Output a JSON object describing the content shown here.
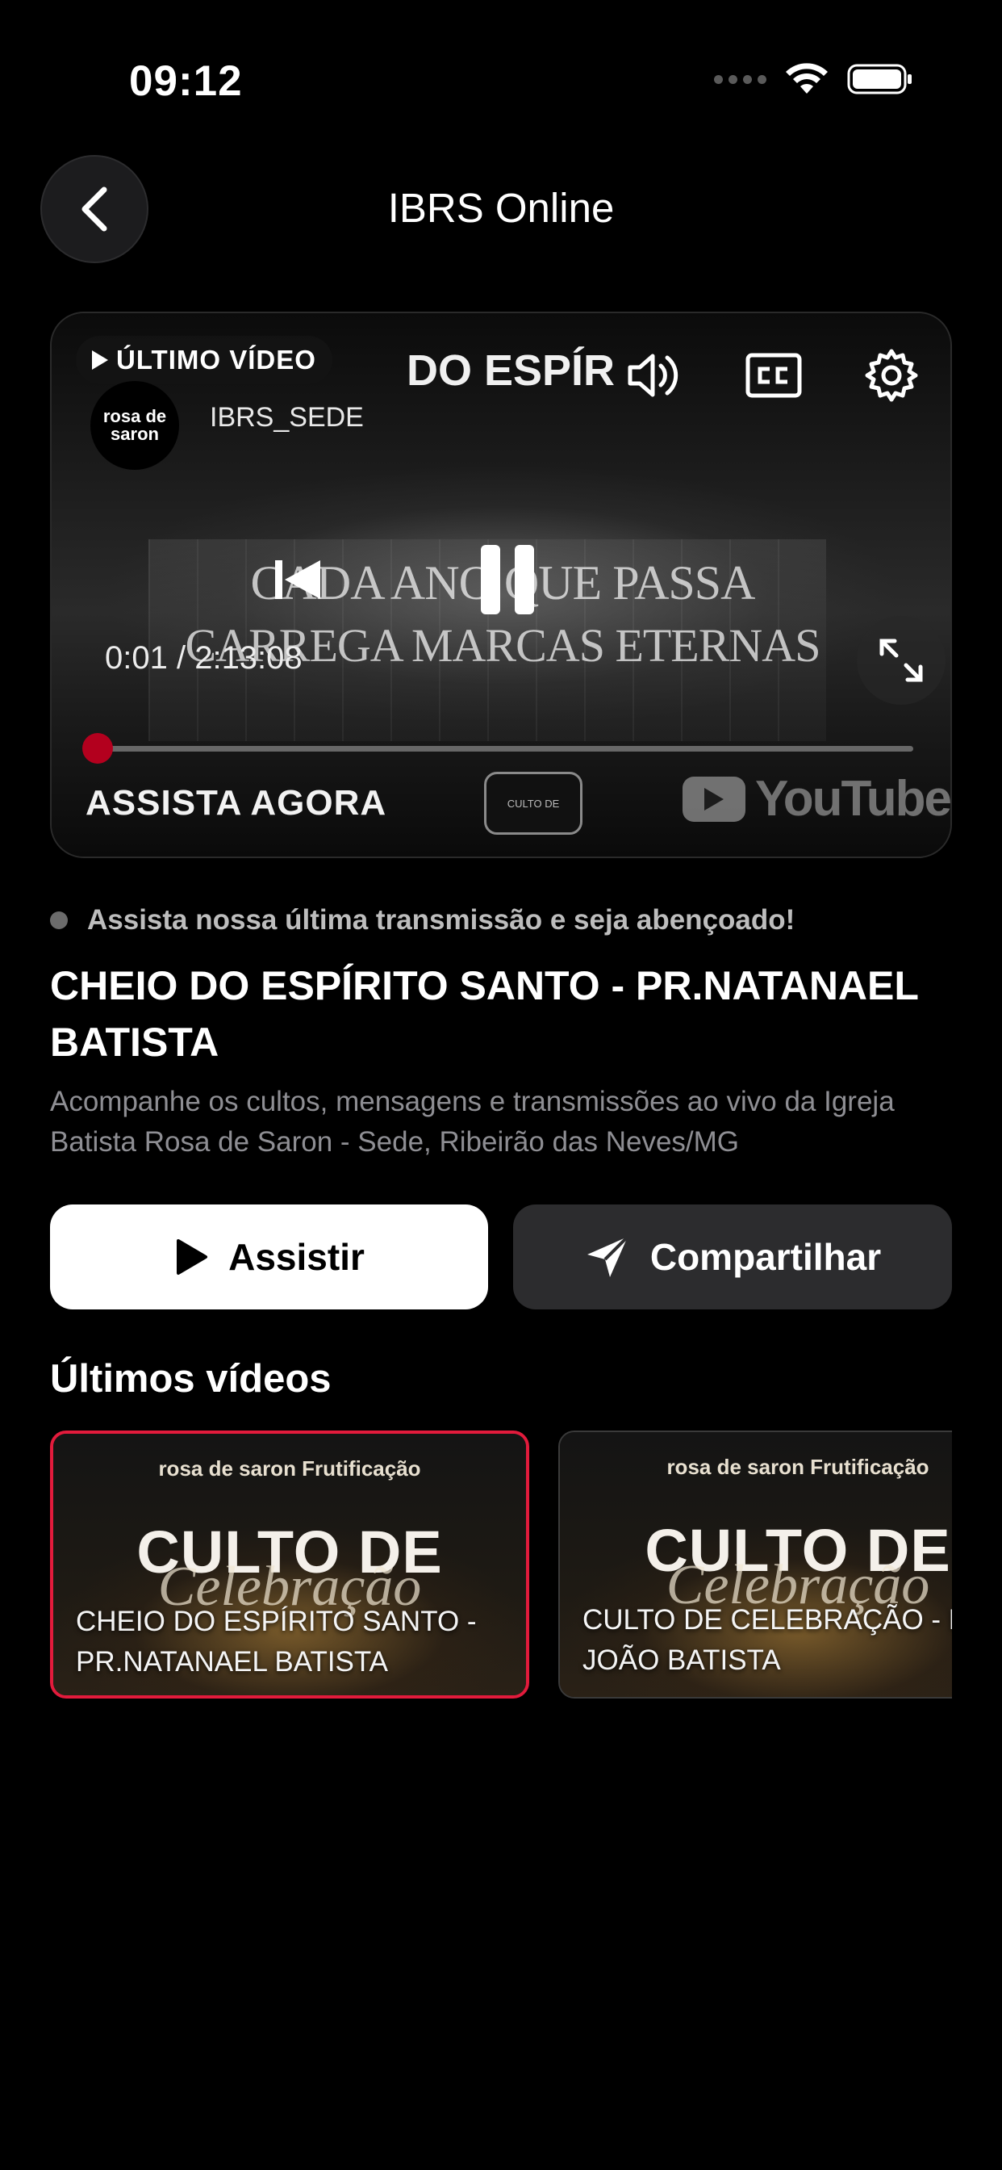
{
  "status_bar": {
    "time": "09:12"
  },
  "header": {
    "title": "IBRS Online"
  },
  "player": {
    "badge": "ÚLTIMO VÍDEO",
    "video_title_visible": "DO ESPÍR",
    "channel_name": "IBRS_SEDE",
    "channel_avatar_line1": "rosa de",
    "channel_avatar_line2": "saron",
    "overlay_line1": "CADA ANO QUE PASSA",
    "overlay_line2": "CARREGA MARCAS ETERNAS",
    "current_time": "0:01",
    "duration": "2:13:08",
    "time_separator": " / ",
    "progress": 0.01,
    "watch_now": "ASSISTA AGORA",
    "youtube_label": "YouTube",
    "mini_thumb_label": "CULTO DE"
  },
  "info": {
    "live_text": "Assista nossa última transmissão e seja abençoado!",
    "title": "CHEIO DO ESPÍRITO SANTO - PR.NATANAEL BATISTA",
    "description": "Acompanhe os cultos, mensagens e transmissões ao vivo da Igreja Batista Rosa de Saron - Sede, Ribeirão das Neves/MG"
  },
  "actions": {
    "watch_label": "Assistir",
    "share_label": "Compartilhar"
  },
  "latest": {
    "section_title": "Últimos vídeos",
    "cards": [
      {
        "brand": "rosa de saron  Frutificação",
        "headline": "CULTO DE",
        "script": "Celebração",
        "caption": "CHEIO DO ESPÍRITO SANTO - PR.NATANAEL BATISTA",
        "selected": true
      },
      {
        "brand": "rosa de saron  Frutificação",
        "headline": "CULTO DE",
        "script": "Celebração",
        "caption": "CULTO DE CELEBRAÇÃO - PR. JOÃO BATISTA",
        "selected": false
      }
    ]
  },
  "colors": {
    "accent_red": "#e21b3c",
    "background": "#000000",
    "secondary_button": "#2c2c2e"
  }
}
